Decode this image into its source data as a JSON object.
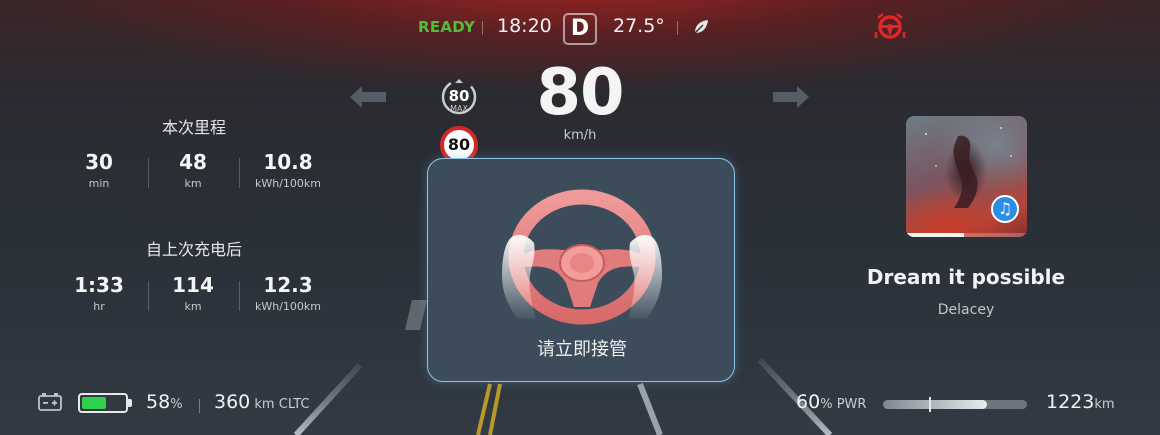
{
  "status_bar": {
    "ready": "READY",
    "time": "18:20",
    "gear": "D",
    "temperature": "27.5°"
  },
  "speed": {
    "value": "80",
    "unit": "km/h"
  },
  "speed_limit": {
    "max_value": "80",
    "max_label": "MAX",
    "sign_value": "80"
  },
  "trip": {
    "title": "本次里程",
    "stats": [
      {
        "value": "30",
        "unit": "min"
      },
      {
        "value": "48",
        "unit": "km"
      },
      {
        "value": "10.8",
        "unit": "kWh/100km"
      }
    ]
  },
  "since_charge": {
    "title": "自上次充电后",
    "stats": [
      {
        "value": "1:33",
        "unit": "hr"
      },
      {
        "value": "114",
        "unit": "km"
      },
      {
        "value": "12.3",
        "unit": "kWh/100km"
      }
    ]
  },
  "alert": {
    "message": "请立即接管",
    "icon": "steering-wheel-hands-icon"
  },
  "music": {
    "song_title": "Dream it possible",
    "artist": "Delacey",
    "progress": 0.48,
    "badge_icon": "music-note-icon"
  },
  "bottom_bar": {
    "battery_percent": "58",
    "battery_percent_unit": "%",
    "battery_level": 0.58,
    "range_value": "360",
    "range_unit": "km",
    "range_standard": "CLTC",
    "power_percent": "60",
    "power_unit": "%",
    "power_label": "PWR",
    "power_level": 0.72,
    "odometer_value": "1223",
    "odometer_unit": "km"
  },
  "colors": {
    "ready_green": "#4fbf3a",
    "warning_red": "#d42828",
    "battery_green": "#2ed24a",
    "dialog_border": "#8ec4e4"
  }
}
